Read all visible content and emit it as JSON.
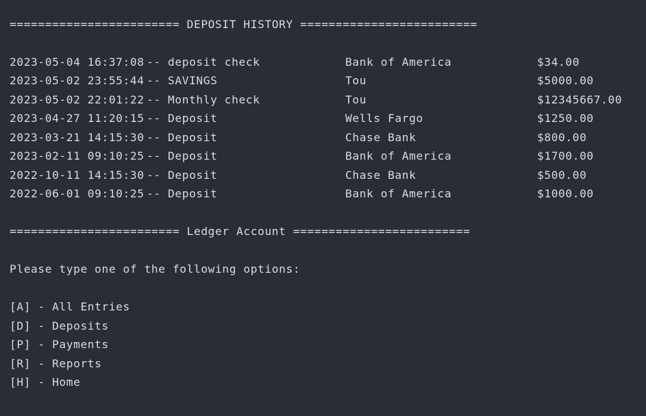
{
  "terminal": {
    "deposit_header": "======================== DEPOSIT HISTORY =========================",
    "deposits": [
      {
        "timestamp": "2023-05-04 16:37:08",
        "description": "-- deposit check",
        "vendor": "Bank of America",
        "amount": "$34.00"
      },
      {
        "timestamp": "2023-05-02 23:55:44",
        "description": "-- SAVINGS",
        "vendor": "Tou",
        "amount": "$5000.00"
      },
      {
        "timestamp": "2023-05-02 22:01:22",
        "description": "-- Monthly check",
        "vendor": "Tou",
        "amount": "$12345667.00"
      },
      {
        "timestamp": "2023-04-27 11:20:15",
        "description": "-- Deposit",
        "vendor": "Wells Fargo",
        "amount": "$1250.00"
      },
      {
        "timestamp": "2023-03-21 14:15:30",
        "description": "-- Deposit",
        "vendor": "Chase Bank",
        "amount": "$800.00"
      },
      {
        "timestamp": "2023-02-11 09:10:25",
        "description": "-- Deposit",
        "vendor": "Bank of America",
        "amount": "$1700.00"
      },
      {
        "timestamp": "2022-10-11 14:15:30",
        "description": "-- Deposit",
        "vendor": "Chase Bank",
        "amount": "$500.00"
      },
      {
        "timestamp": "2022-06-01 09:10:25",
        "description": "-- Deposit",
        "vendor": "Bank of America",
        "amount": "$1000.00"
      }
    ],
    "ledger_header": "======================== Ledger Account =========================",
    "prompt": "Please type one of the following options:",
    "options": [
      "[A] - All Entries",
      "[D] - Deposits",
      "[P] - Payments",
      "[R] - Reports",
      "[H] - Home"
    ]
  },
  "colors": {
    "background": "#2a2c36",
    "text": "#dcdcdc"
  }
}
